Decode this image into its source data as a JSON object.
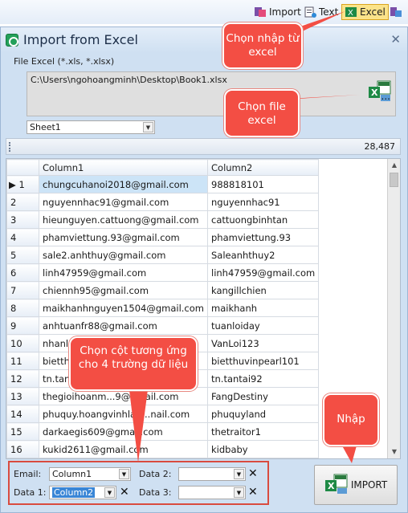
{
  "toolbar": {
    "import_label": "Import",
    "text_label": "Text",
    "excel_label": "Excel",
    "active_color": "#fbe38a"
  },
  "window": {
    "title": "Import from Excel",
    "close_label": "✕",
    "file_label": "File Excel (*.xls, *.xlsx)",
    "file_path": "C:\\Users\\ngohoangminh\\Desktop\\Book1.xlsx",
    "browse_label": "...",
    "sheet": "Sheet1",
    "record_count": "28,487"
  },
  "grid": {
    "headers": [
      "Column1",
      "Column2"
    ],
    "rows": [
      {
        "n": "1",
        "c1": "chungcuhanoi2018@gmail.com",
        "c2": "988818101"
      },
      {
        "n": "2",
        "c1": "nguyennhac91@gmail.com",
        "c2": "nguyennhac91"
      },
      {
        "n": "3",
        "c1": "hieunguyen.cattuong@gmail.com",
        "c2": "cattuongbinhtan"
      },
      {
        "n": "4",
        "c1": "phamviettung.93@gmail.com",
        "c2": "phamviettung.93"
      },
      {
        "n": "5",
        "c1": "sale2.anhthuy@gmail.com",
        "c2": "Saleanhthuy2"
      },
      {
        "n": "6",
        "c1": "linh47959@gmail.com",
        "c2": "linh47959@gmail.com"
      },
      {
        "n": "7",
        "c1": "chiennh95@gmail.com",
        "c2": "kangillchien"
      },
      {
        "n": "8",
        "c1": "maikhanhnguyen1504@gmail.com",
        "c2": "maikhanh"
      },
      {
        "n": "9",
        "c1": "anhtuanfr88@gmail.com",
        "c2": "tuanloiday"
      },
      {
        "n": "10",
        "c1": "nhanla",
        "c2": "VanLoi123"
      },
      {
        "n": "11",
        "c1": "bietthu",
        "c2": "bietthuvinpearl101"
      },
      {
        "n": "12",
        "c1": "tn.tanta",
        "c2": "tn.tantai92"
      },
      {
        "n": "13",
        "c1": "thegioihoanm...9@gmail.com",
        "c2": "FangDestiny"
      },
      {
        "n": "14",
        "c1": "phuquy.hoangvinhlan...nail.com",
        "c2": "phuquyland"
      },
      {
        "n": "15",
        "c1": "darkaegis609@gmail.com",
        "c2": "thetraitor1"
      },
      {
        "n": "16",
        "c1": "kukid2611@gmail.com",
        "c2": "kidbaby"
      }
    ]
  },
  "fields": {
    "email_label": "Email:",
    "email_value": "Column1",
    "data1_label": "Data 1:",
    "data1_value": "Column2",
    "data2_label": "Data 2:",
    "data2_value": "",
    "data3_label": "Data 3:",
    "data3_value": "",
    "clear_label": "✕"
  },
  "import_button": "IMPORT",
  "callouts": {
    "nhap_excel": "Chọn nhập từ excel",
    "chon_file": "Chọn file excel",
    "chon_cot": "Chọn cột tương ứng cho 4 trường dữ liệu",
    "nhap": "Nhập",
    "color": "#f34e44"
  }
}
